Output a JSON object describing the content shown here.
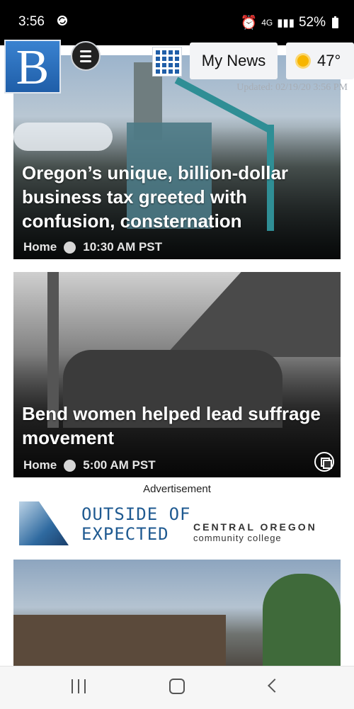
{
  "status_bar": {
    "time": "3:56",
    "network": "4G",
    "battery": "52%"
  },
  "header": {
    "logo_letter": "B",
    "my_news_label": "My News",
    "weather_temp": "47°",
    "updated_text": "Updated: 02/19/20 3:56 PM"
  },
  "articles": [
    {
      "title": "Oregon’s unique, billion-dollar business tax greeted with confusion, consternation",
      "section": "Home",
      "time": "10:30 AM PST"
    },
    {
      "title": "Bend women helped lead suffrage movement",
      "section": "Home",
      "time": "5:00 AM PST"
    }
  ],
  "advertisement": {
    "label": "Advertisement",
    "tagline_line1": "OUTSIDE OF",
    "tagline_line2": "EXPECTED",
    "brand_line1": "CENTRAL OREGON",
    "brand_line2": "community college"
  }
}
